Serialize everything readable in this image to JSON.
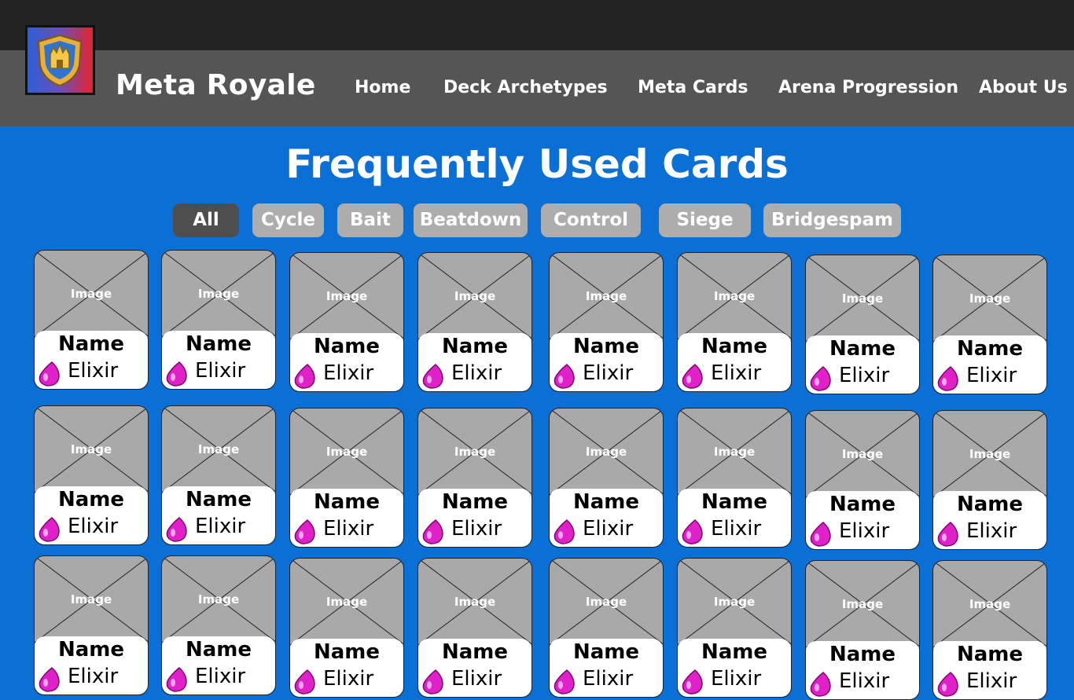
{
  "brand": {
    "name": "Meta Royale",
    "logo_icon": "crown-shield-icon"
  },
  "nav": [
    {
      "label": "Home"
    },
    {
      "label": "Deck Archetypes"
    },
    {
      "label": "Meta Cards"
    },
    {
      "label": "Arena Progression"
    },
    {
      "label": "About Us"
    }
  ],
  "page": {
    "title": "Frequently Used Cards"
  },
  "filters": [
    {
      "label": "All",
      "active": true
    },
    {
      "label": "Cycle"
    },
    {
      "label": "Bait"
    },
    {
      "label": "Beatdown"
    },
    {
      "label": "Control"
    },
    {
      "label": "Siege"
    },
    {
      "label": "Bridgespam"
    }
  ],
  "card_template": {
    "image_label": "Image",
    "name": "Name",
    "elixir": "Elixir",
    "elixir_icon": "elixir-drop-icon"
  },
  "colors": {
    "background": "#0a70d6",
    "topbar": "#232323",
    "navbar": "#555555",
    "filter": "#adadad",
    "filter_active": "#4e4e4e",
    "card_image": "#a9a9a9",
    "elixir": "#e020c8"
  }
}
